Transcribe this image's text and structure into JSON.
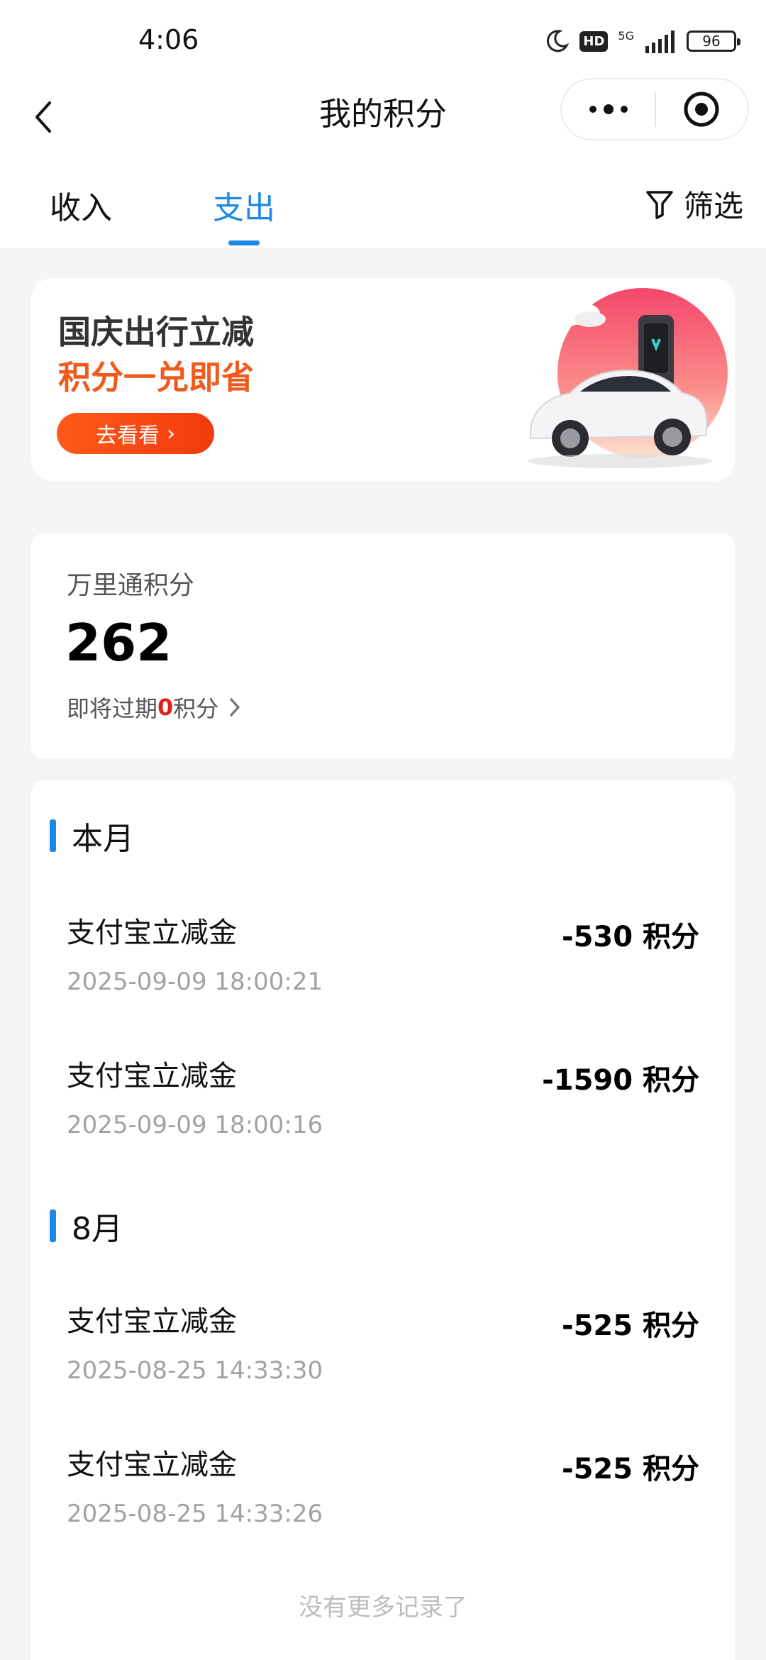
{
  "status_bar": {
    "time": "4:06",
    "hd": "HD",
    "network": "5G",
    "battery": "96"
  },
  "nav": {
    "title": "我的积分"
  },
  "tabs": [
    {
      "label": "收入",
      "active": false
    },
    {
      "label": "支出",
      "active": true
    }
  ],
  "filter": {
    "label": "筛选"
  },
  "promo": {
    "title": "国庆出行立减",
    "subtitle": "积分一兑即省",
    "button_label": "去看看",
    "button_chevron": "›"
  },
  "points": {
    "label": "万里通积分",
    "value": "262",
    "expire_prefix": "即将过期",
    "expire_count": "0",
    "expire_suffix": "积分"
  },
  "sections": [
    {
      "title": "本月",
      "records": [
        {
          "name": "支付宝立减金",
          "amount": "-530 积分",
          "time": "2025-09-09 18:00:21"
        },
        {
          "name": "支付宝立减金",
          "amount": "-1590 积分",
          "time": "2025-09-09 18:00:16"
        }
      ]
    },
    {
      "title": "8月",
      "records": [
        {
          "name": "支付宝立减金",
          "amount": "-525 积分",
          "time": "2025-08-25 14:33:30"
        },
        {
          "name": "支付宝立减金",
          "amount": "-525 积分",
          "time": "2025-08-25 14:33:26"
        }
      ]
    }
  ],
  "end_text": "没有更多记录了",
  "colors": {
    "accent": "#1e88e5",
    "promo_orange": "#f25a1d",
    "expire_red": "#e0201b",
    "muted_text": "#a2a2a2"
  },
  "icons": {
    "back": "chevron-left-icon",
    "more": "more-dots-icon",
    "close": "target-circle-icon",
    "filter": "funnel-icon",
    "expire_chevron": "chevron-right-icon"
  }
}
